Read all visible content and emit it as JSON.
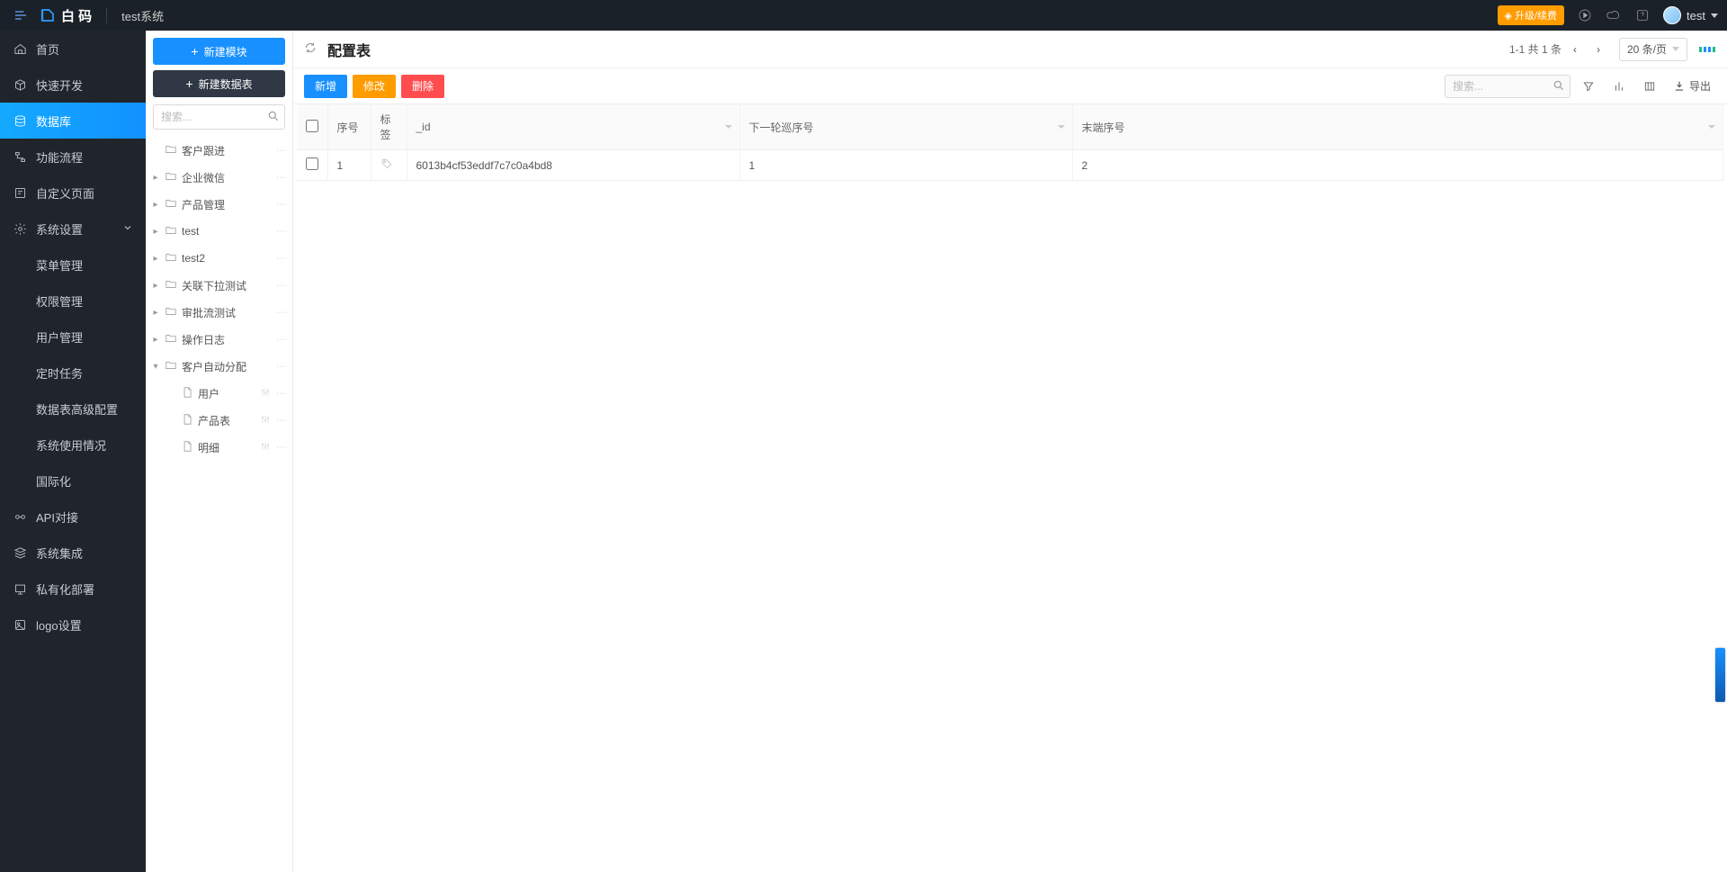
{
  "topbar": {
    "brand": "白 码",
    "system_name": "test系统",
    "upgrade_label": "升级/续费",
    "user_name": "test"
  },
  "leftnav": {
    "items": [
      {
        "icon": "home",
        "label": "首页"
      },
      {
        "icon": "cube",
        "label": "快速开发"
      },
      {
        "icon": "database",
        "label": "数据库",
        "active": true
      },
      {
        "icon": "flow",
        "label": "功能流程"
      },
      {
        "icon": "page",
        "label": "自定义页面"
      },
      {
        "icon": "gear",
        "label": "系统设置",
        "expandable": true
      }
    ],
    "settings_children": [
      "菜单管理",
      "权限管理",
      "用户管理",
      "定时任务",
      "数据表高级配置",
      "系统使用情况",
      "国际化"
    ],
    "tail": [
      {
        "icon": "api",
        "label": "API对接"
      },
      {
        "icon": "stack",
        "label": "系统集成"
      },
      {
        "icon": "deploy",
        "label": "私有化部署"
      },
      {
        "icon": "logo",
        "label": "logo设置"
      }
    ]
  },
  "modbar": {
    "new_module": "新建模块",
    "new_table": "新建数据表",
    "search_placeholder": "搜索...",
    "tree": [
      {
        "label": "客户跟进",
        "type": "folder",
        "state": "leaf0"
      },
      {
        "label": "企业微信",
        "type": "folder",
        "state": "collapsed"
      },
      {
        "label": "产品管理",
        "type": "folder",
        "state": "collapsed"
      },
      {
        "label": "test",
        "type": "folder",
        "state": "collapsed"
      },
      {
        "label": "test2",
        "type": "folder",
        "state": "collapsed"
      },
      {
        "label": "关联下拉测试",
        "type": "folder",
        "state": "collapsed"
      },
      {
        "label": "审批流测试",
        "type": "folder",
        "state": "collapsed"
      },
      {
        "label": "操作日志",
        "type": "folder",
        "state": "collapsed"
      },
      {
        "label": "客户自动分配",
        "type": "folder",
        "state": "expanded"
      }
    ],
    "leaves": [
      {
        "label": "用户"
      },
      {
        "label": "产品表"
      },
      {
        "label": "明细"
      }
    ]
  },
  "main": {
    "title": "配置表",
    "paging_text": "1-1 共 1 条",
    "perpage_label": "20 条/页",
    "buttons": {
      "add": "新增",
      "edit": "修改",
      "del": "删除"
    },
    "search_placeholder": "搜索...",
    "export_label": "导出",
    "columns": {
      "seq": "序号",
      "tag": "标签",
      "id": "_id",
      "next": "下一轮巡序号",
      "tail": "末端序号"
    },
    "rows": [
      {
        "seq": "1",
        "id": "6013b4cf53eddf7c7c0a4bd8",
        "next": "1",
        "tail": "2"
      }
    ]
  }
}
